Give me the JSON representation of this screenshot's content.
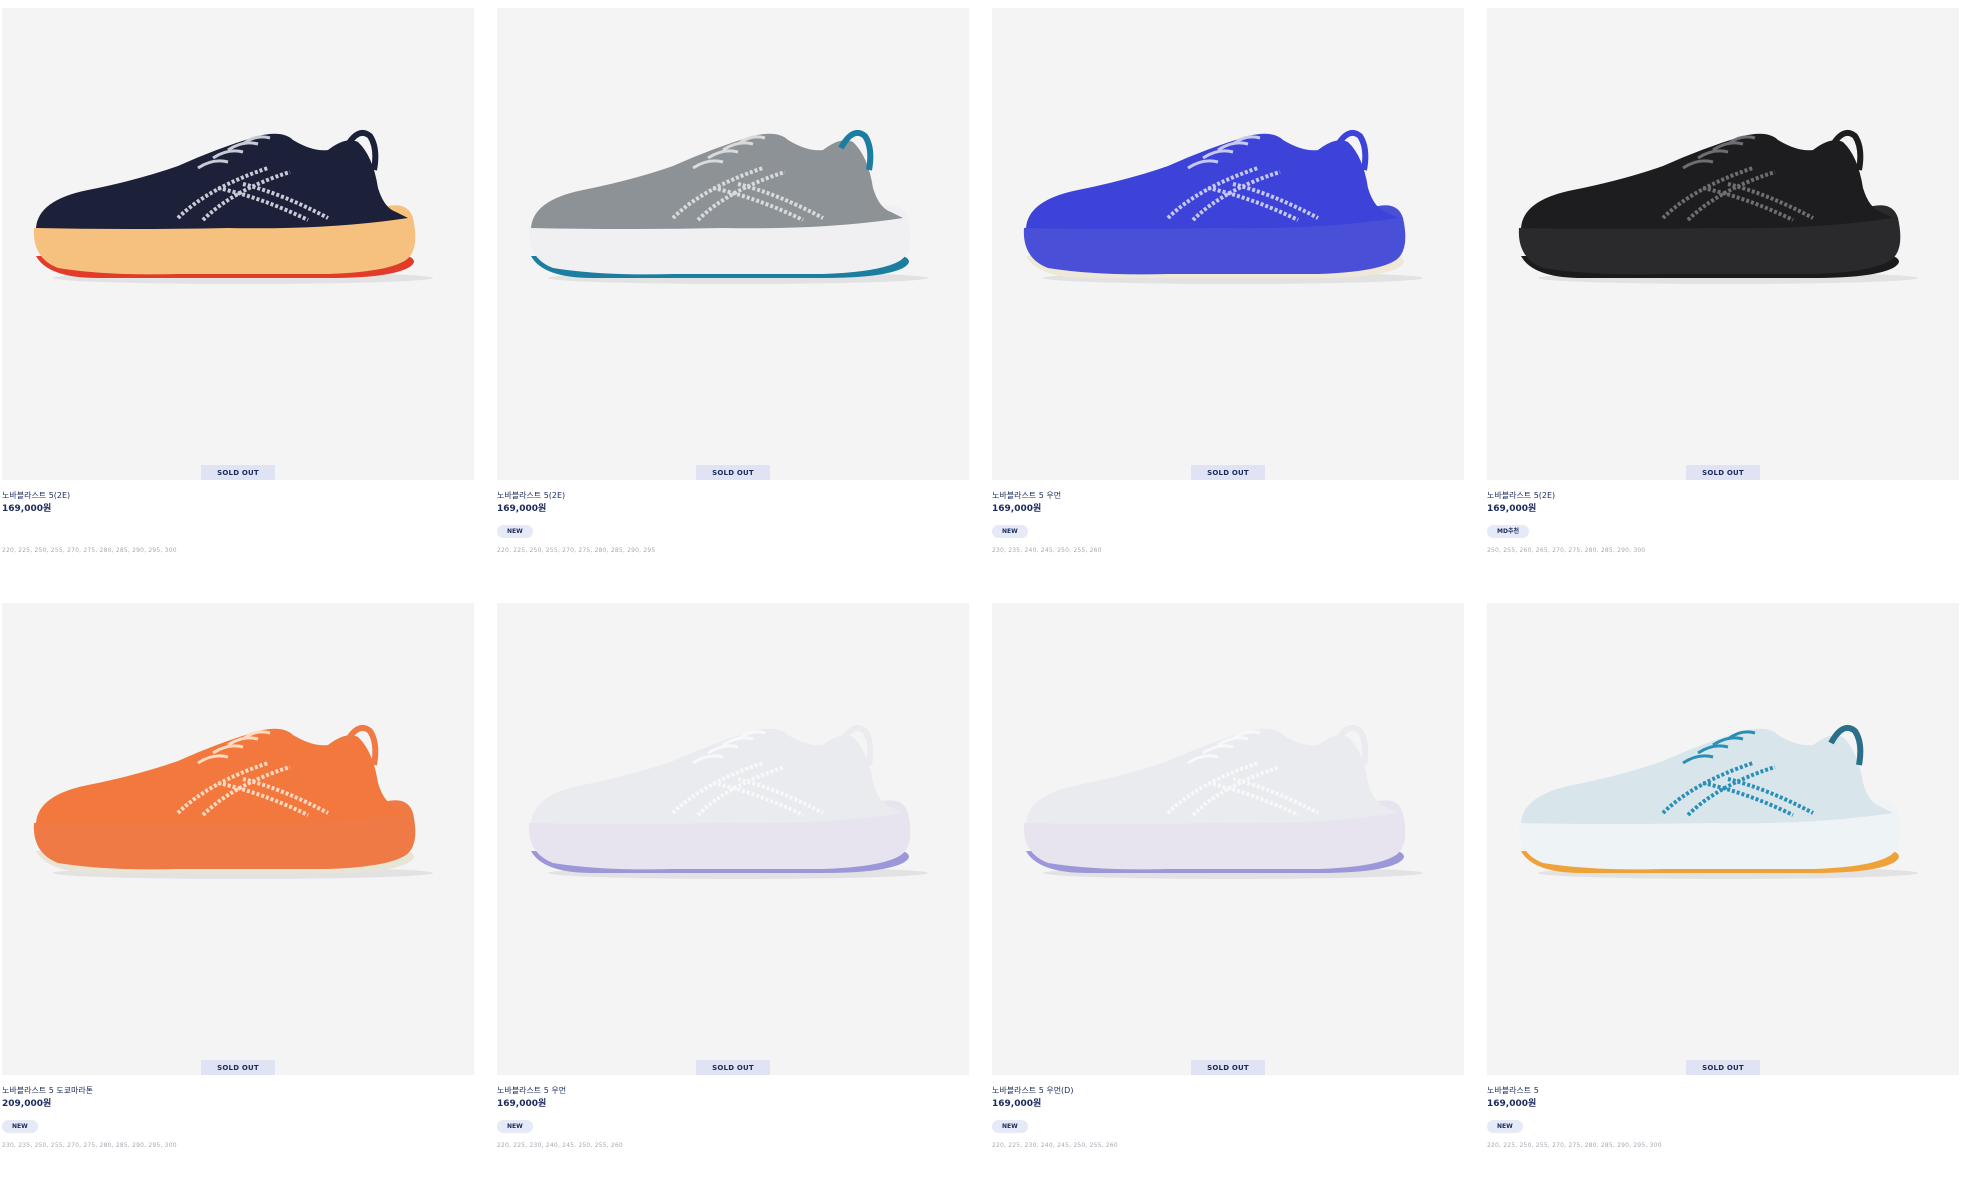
{
  "products": [
    {
      "name": "노바블라스트 5(2E)",
      "price": "169,000원",
      "badge": "",
      "status": "SOLD OUT",
      "sizes": "220, 225, 250, 255, 270, 275, 280, 285, 290, 295, 300",
      "colors": {
        "upper": "#1c2038",
        "pattern": "#c8cbd6",
        "sole": "#f6c07e",
        "outsole": "#e23b2a",
        "collar": "#1c2038"
      }
    },
    {
      "name": "노바블라스트 5(2E)",
      "price": "169,000원",
      "badge": "NEW",
      "status": "SOLD OUT",
      "sizes": "220, 225, 250, 255, 270, 275, 280, 285, 290, 295",
      "colors": {
        "upper": "#8d9296",
        "pattern": "#d8dadc",
        "sole": "#f0f0f2",
        "outsole": "#1b7da0",
        "collar": "#1b7da0"
      }
    },
    {
      "name": "노바블라스트 5 우먼",
      "price": "169,000원",
      "badge": "NEW",
      "status": "SOLD OUT",
      "sizes": "230, 235, 240, 245, 250, 255, 260",
      "colors": {
        "upper": "#3d43d8",
        "pattern": "#c6c9f3",
        "sole": "#4a4fd8",
        "outsole": "#efe8d6",
        "collar": "#3d43d8"
      }
    },
    {
      "name": "노바블라스트 5(2E)",
      "price": "169,000원",
      "badge": "MD추천",
      "status": "SOLD OUT",
      "sizes": "250, 255, 260, 265, 270, 275, 280, 285, 290, 300",
      "colors": {
        "upper": "#1d1d1f",
        "pattern": "#6d6e72",
        "sole": "#2a2a2c",
        "outsole": "#1b1b1b",
        "collar": "#1d1d1f"
      }
    },
    {
      "name": "노바블라스트 5 도쿄마라톤",
      "price": "209,000원",
      "badge": "NEW",
      "status": "SOLD OUT",
      "sizes": "230, 235, 250, 255, 270, 275, 280, 285, 290, 295, 300",
      "colors": {
        "upper": "#f2783d",
        "pattern": "#ffd9c2",
        "sole": "#f07a45",
        "outsole": "#e8e4d6",
        "collar": "#f07a45"
      }
    },
    {
      "name": "노바블라스트 5 우먼",
      "price": "169,000원",
      "badge": "NEW",
      "status": "SOLD OUT",
      "sizes": "220, 225, 230, 240, 245, 250, 255, 260",
      "colors": {
        "upper": "#e9ebee",
        "pattern": "#f7f8f9",
        "sole": "#e7e4f0",
        "outsole": "#9b97d8",
        "collar": "#e9ebee"
      }
    },
    {
      "name": "노바블라스트 5 우먼(D)",
      "price": "169,000원",
      "badge": "NEW",
      "status": "SOLD OUT",
      "sizes": "220, 225, 230, 240, 245, 250, 255, 260",
      "colors": {
        "upper": "#e9ebee",
        "pattern": "#f7f8f9",
        "sole": "#e7e4f0",
        "outsole": "#9b97d8",
        "collar": "#e9ebee"
      }
    },
    {
      "name": "노바블라스트 5",
      "price": "169,000원",
      "badge": "NEW",
      "status": "SOLD OUT",
      "sizes": "220, 225, 250, 255, 270, 275, 280, 285, 290, 295, 300",
      "colors": {
        "upper": "#d8e6ec",
        "pattern": "#2a8fb6",
        "sole": "#eef3f5",
        "outsole": "#f0a23a",
        "collar": "#2a6f8a"
      }
    }
  ]
}
